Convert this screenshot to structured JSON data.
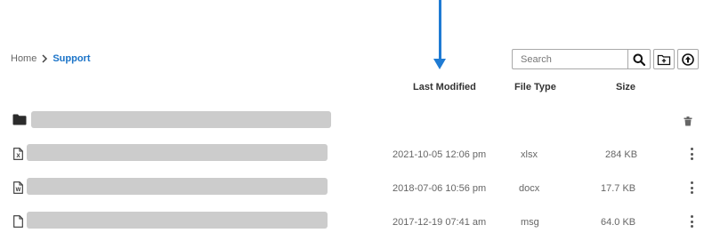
{
  "breadcrumb": {
    "home": "Home",
    "current": "Support"
  },
  "search": {
    "placeholder": "Search"
  },
  "columns": {
    "modified": "Last Modified",
    "type": "File Type",
    "size": "Size"
  },
  "rows": [
    {
      "kind": "folder",
      "modified": "",
      "type": "",
      "size": ""
    },
    {
      "kind": "excel-file",
      "modified": "2021-10-05 12:06 pm",
      "type": "xlsx",
      "size": "284 KB"
    },
    {
      "kind": "word-file",
      "modified": "2018-07-06 10:56 pm",
      "type": "docx",
      "size": "17.7 KB"
    },
    {
      "kind": "generic-file",
      "modified": "2017-12-19 07:41 am",
      "type": "msg",
      "size": "64.0 KB"
    }
  ],
  "colors": {
    "accent": "#1a73c8",
    "annotation_arrow": "#1f7bd3",
    "placeholder_bar": "#cccccc"
  }
}
